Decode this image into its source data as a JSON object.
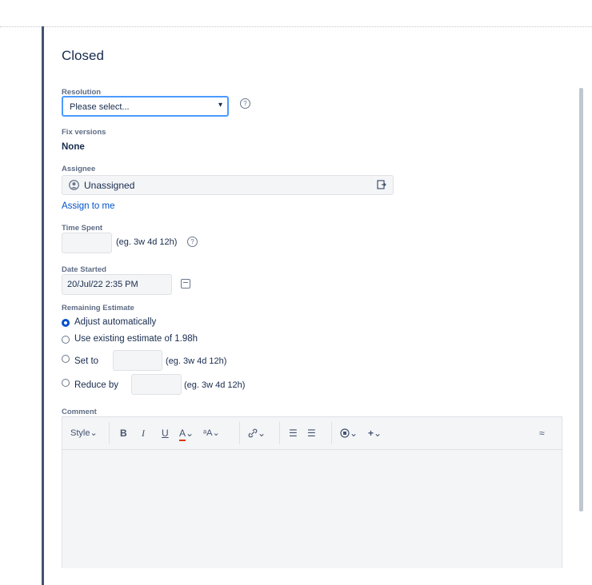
{
  "dialog": {
    "title": "Closed"
  },
  "resolution": {
    "label": "Resolution",
    "selected": "Please select...",
    "help_glyph": "?"
  },
  "fix_versions": {
    "label": "Fix versions",
    "value": "None"
  },
  "assignee": {
    "label": "Assignee",
    "value": "Unassigned",
    "assign_to_me": "Assign to me"
  },
  "time_spent": {
    "label": "Time Spent",
    "value": "",
    "hint": "(eg. 3w 4d 12h)",
    "help_glyph": "?"
  },
  "date_started": {
    "label": "Date Started",
    "value": "20/Jul/22 2:35 PM"
  },
  "remaining_estimate": {
    "label": "Remaining Estimate",
    "options": [
      {
        "label": "Adjust automatically",
        "selected": true
      },
      {
        "label": "Use existing estimate of 1.98h",
        "selected": false
      },
      {
        "label": "Set to",
        "selected": false,
        "hint": "(eg. 3w 4d 12h)"
      },
      {
        "label": "Reduce by",
        "selected": false,
        "hint": "(eg. 3w 4d 12h)"
      }
    ]
  },
  "comment": {
    "label": "Comment",
    "toolbar": {
      "style": "Style",
      "bold": "B",
      "italic": "I",
      "underline": "U",
      "text_color": "A",
      "text_size": "ᵃA",
      "list_bullet": "☰",
      "list_numbered": "☰",
      "chevron": "⌄",
      "plus": "+",
      "collapse": "≈"
    },
    "text_color_accent": "#de350b"
  },
  "colors": {
    "link": "#0052cc",
    "focus": "#4c9aff",
    "radio": "#0052cc"
  }
}
